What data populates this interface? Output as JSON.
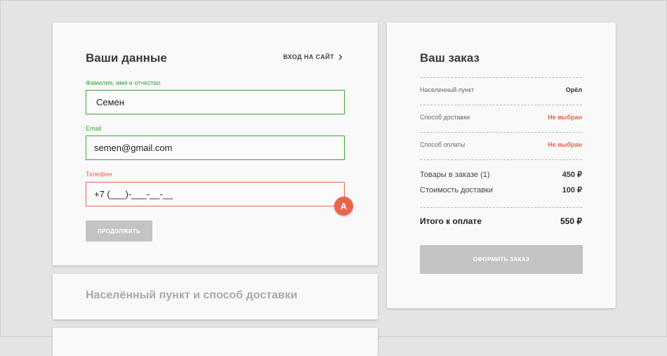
{
  "personal": {
    "title": "Ваши данные",
    "login_link": "ВХОД НА САЙТ",
    "fields": {
      "name": {
        "label": "Фамилия, имя и отчество",
        "value": "Семен"
      },
      "email": {
        "label": "Email",
        "value": "semen@gmail.com"
      },
      "phone": {
        "label": "Телефон",
        "value": "+7 (___)-___-__-__",
        "badge": "A"
      }
    },
    "continue_label": "ПРОДОЛЖИТЬ"
  },
  "delivery": {
    "title": "Населённый пункт и способ доставки"
  },
  "order": {
    "title": "Ваш заказ",
    "rows": [
      {
        "label": "Населенный пункт",
        "value": "Орёл"
      },
      {
        "label": "Способ доставки",
        "value": "Не выбран"
      },
      {
        "label": "Способ оплаты",
        "value": "Не выбран"
      }
    ],
    "summary": [
      {
        "label": "Товары в заказе (1)",
        "value": "450 ₽"
      },
      {
        "label": "Стоимость доставки",
        "value": "100 ₽"
      }
    ],
    "total": {
      "label": "Итого к оплате",
      "value": "550 ₽"
    },
    "submit_label": "ОФОРМИТЬ ЗАКАЗ"
  },
  "colors": {
    "valid": "#3aa43a",
    "error": "#e8654c",
    "button_disabled": "#c3c3c3",
    "background": "#e4e4e4",
    "card": "#f9f9f9"
  },
  "icons": {
    "login_link": "chevron-right-icon"
  }
}
